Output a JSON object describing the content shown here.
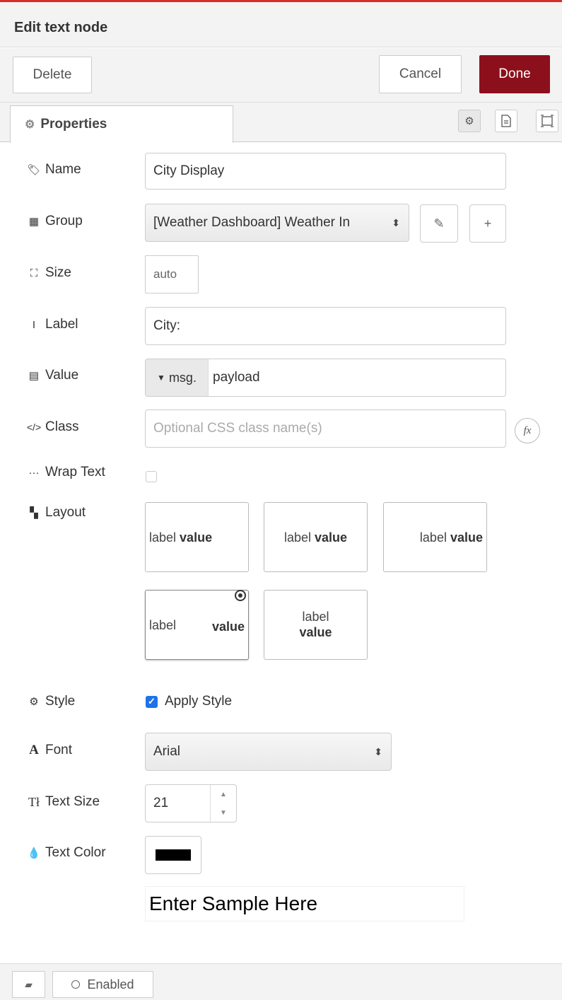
{
  "header": {
    "title": "Edit text node"
  },
  "toolbar": {
    "delete_label": "Delete",
    "cancel_label": "Cancel",
    "done_label": "Done"
  },
  "tabs": {
    "active_label": "Properties",
    "icons": [
      "gear-icon",
      "document-icon",
      "frame-icon"
    ]
  },
  "form": {
    "name": {
      "label": "Name",
      "value": "City Display"
    },
    "group": {
      "label": "Group",
      "value": "[Weather Dashboard] Weather In"
    },
    "size": {
      "label": "Size",
      "value": "auto"
    },
    "label": {
      "label": "Label",
      "value": "City:"
    },
    "value": {
      "label": "Value",
      "type_prefix": "msg.",
      "value": "payload"
    },
    "class": {
      "label": "Class",
      "placeholder": "Optional CSS class name(s)",
      "fx": "fx"
    },
    "wrap_text": {
      "label": "Wrap Text",
      "checked": false
    },
    "layout": {
      "label": "Layout",
      "options": [
        {
          "label": "label",
          "value": "value"
        },
        {
          "label": "label",
          "value": "value"
        },
        {
          "label": "label",
          "value": "value"
        },
        {
          "label": "label",
          "value": "value",
          "selected": true
        },
        {
          "label": "label",
          "value": "value"
        }
      ]
    },
    "style": {
      "label": "Style",
      "checkbox_label": "Apply Style",
      "checked": true
    },
    "font": {
      "label": "Font",
      "value": "Arial"
    },
    "text_size": {
      "label": "Text Size",
      "value": "21"
    },
    "text_color": {
      "label": "Text Color",
      "value": "#000000"
    },
    "sample": {
      "placeholder": "Enter Sample Here"
    }
  },
  "footer": {
    "enabled_label": "Enabled"
  },
  "colors": {
    "done": "#8c101c",
    "accent_line": "#d62d2d",
    "checkbox": "#1e73e8"
  }
}
